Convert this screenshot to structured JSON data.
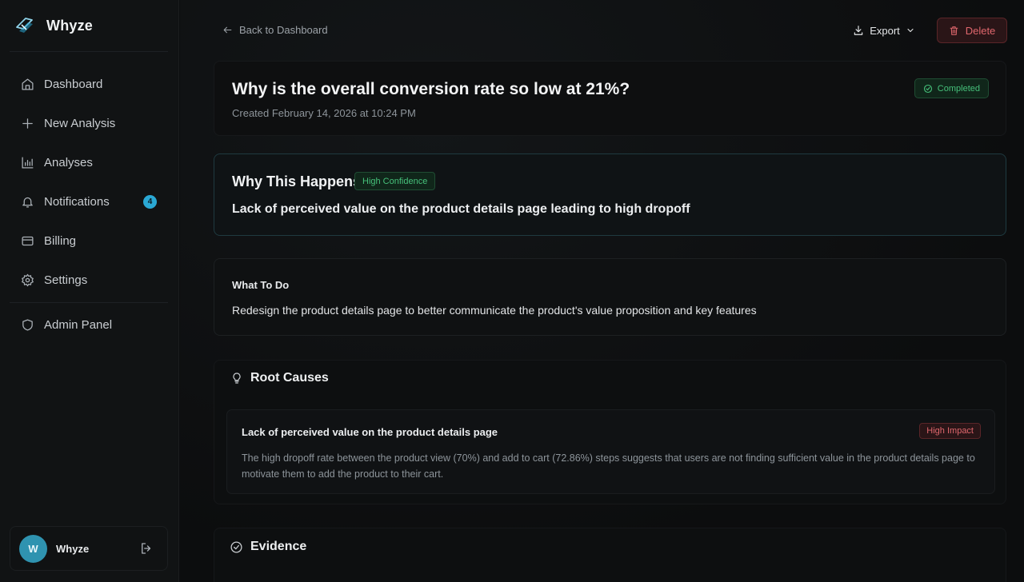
{
  "app": {
    "name": "Whyze"
  },
  "sidebar": {
    "items": [
      {
        "label": "Dashboard",
        "icon": "home-icon"
      },
      {
        "label": "New Analysis",
        "icon": "plus-icon"
      },
      {
        "label": "Analyses",
        "icon": "bar-chart-icon"
      },
      {
        "label": "Notifications",
        "icon": "bell-icon",
        "badge": "4"
      },
      {
        "label": "Billing",
        "icon": "credit-card-icon"
      },
      {
        "label": "Settings",
        "icon": "gear-icon"
      },
      {
        "label": "Admin Panel",
        "icon": "shield-icon"
      }
    ],
    "user": {
      "initial": "W",
      "name": "Whyze"
    }
  },
  "header": {
    "back_label": "Back to Dashboard",
    "export_label": "Export",
    "delete_label": "Delete"
  },
  "analysis": {
    "title": "Why is the overall conversion rate so low at 21%?",
    "created": "Created February 14, 2026 at 10:24 PM",
    "status": "Completed",
    "why": {
      "heading": "Why This Happens",
      "confidence": "High Confidence",
      "text": "Lack of perceived value on the product details page leading to high dropoff"
    },
    "todo": {
      "heading": "What To Do",
      "text": "Redesign the product details page to better communicate the product's value proposition and key features"
    },
    "root_causes": {
      "heading": "Root Causes",
      "items": [
        {
          "title": "Lack of perceived value on the product details page",
          "impact": "High Impact",
          "description": "The high dropoff rate between the product view (70%) and add to cart (72.86%) steps suggests that users are not finding sufficient value in the product details page to motivate them to add the product to their cart."
        }
      ]
    },
    "evidence": {
      "heading": "Evidence"
    }
  },
  "colors": {
    "accent": "#2aa8d4",
    "success": "#46c07a",
    "danger": "#e0676d"
  }
}
